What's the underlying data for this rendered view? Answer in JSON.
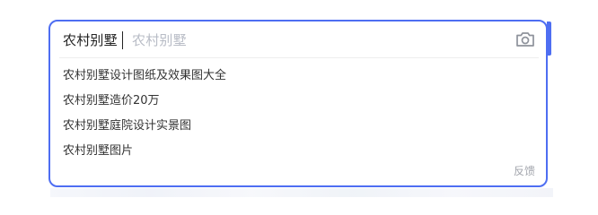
{
  "search": {
    "query": "农村别墅",
    "ghost_suggestion": "农村别墅",
    "camera_icon": "camera-icon"
  },
  "suggestions": [
    {
      "label": "农村别墅设计图纸及效果图大全"
    },
    {
      "label": "农村别墅造价20万"
    },
    {
      "label": "农村别墅庭院设计实景图"
    },
    {
      "label": "农村别墅图片"
    }
  ],
  "footer": {
    "feedback_label": "反馈"
  },
  "colors": {
    "accent": "#4e6ef2",
    "text": "#333333",
    "muted": "#a3a6ad"
  }
}
